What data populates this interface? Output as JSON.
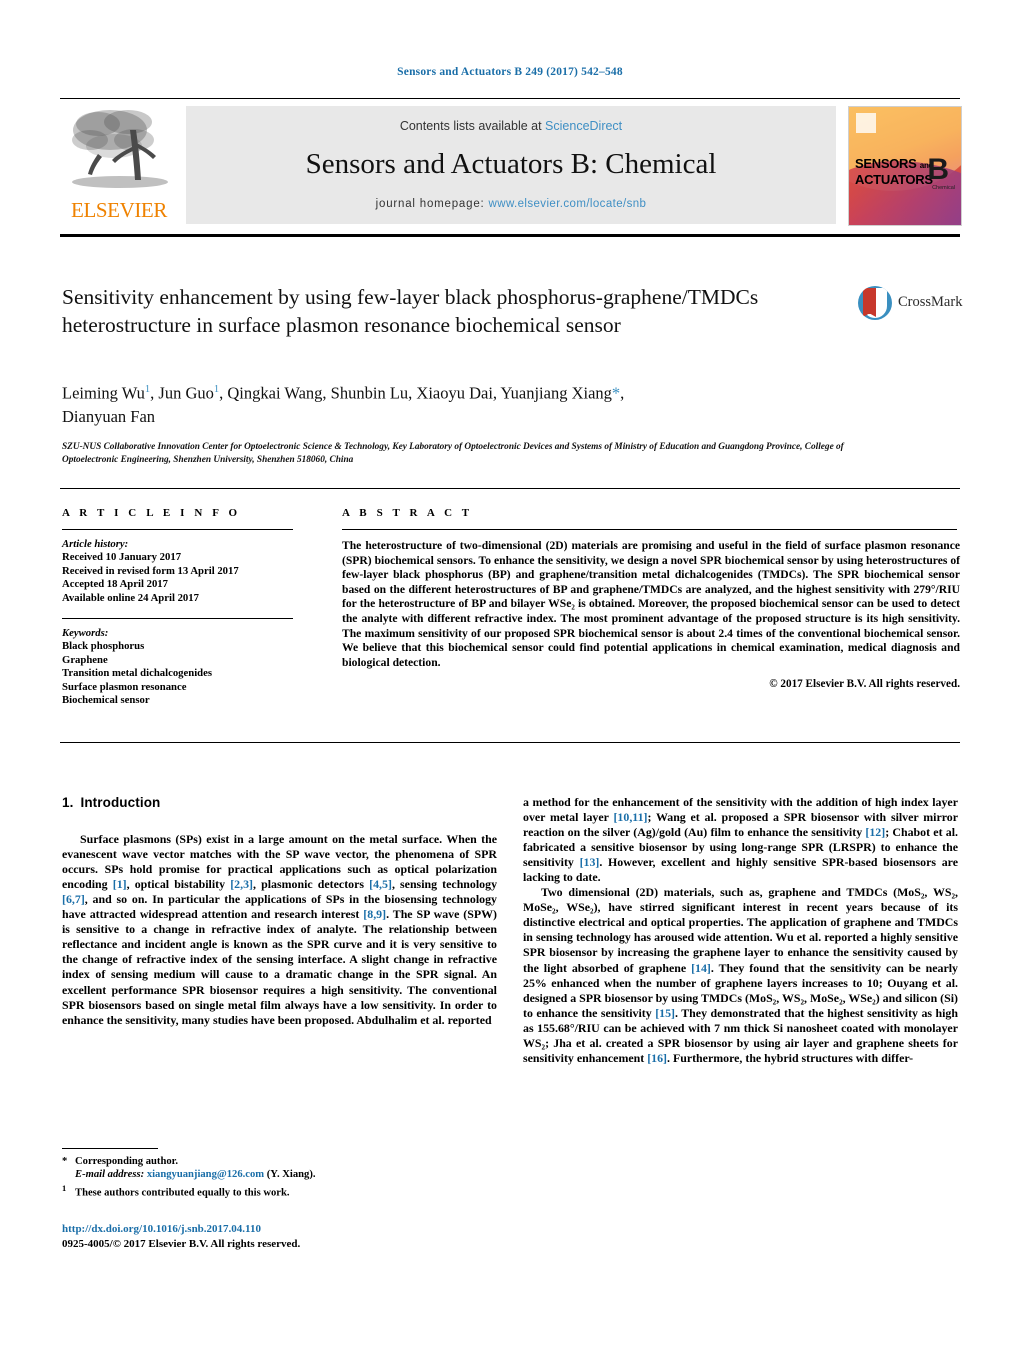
{
  "running_head": "Sensors and Actuators B 249 (2017) 542–548",
  "masthead": {
    "contents_prefix": "Contents lists available at ",
    "sciencedirect": "ScienceDirect",
    "journal_title": "Sensors and Actuators B: Chemical",
    "homepage_label": "journal homepage:",
    "homepage_url": "www.elsevier.com/locate/snb",
    "publisher": "ELSEVIER",
    "cover_line1": "SENSORS",
    "cover_and": "and",
    "cover_line2": "ACTUATORS",
    "cover_letter": "B",
    "cover_sub": "Chemical"
  },
  "article": {
    "title": "Sensitivity enhancement by using few-layer black phosphorus-graphene/TMDCs heterostructure in surface plasmon resonance biochemical sensor",
    "crossmark_label": "CrossMark",
    "authors_line1_a": "Leiming Wu",
    "authors_line1_b": ", Jun Guo",
    "authors_line1_c": ", Qingkai Wang, Shunbin Lu, Xiaoyu Dai, Yuanjiang Xiang",
    "authors_line2": "Dianyuan Fan",
    "author_mark_1": "1",
    "author_star": "*",
    "affiliation": "SZU-NUS Collaborative Innovation Center for Optoelectronic Science & Technology, Key Laboratory of Optoelectronic Devices and Systems of Ministry of Education and Guangdong Province, College of Optoelectronic Engineering, Shenzhen University, Shenzhen 518060, China"
  },
  "article_info": {
    "heading": "A R T I C L E   I N F O",
    "history_label": "Article history:",
    "history": [
      "Received 10 January 2017",
      "Received in revised form 13 April 2017",
      "Accepted 18 April 2017",
      "Available online 24 April 2017"
    ],
    "keywords_label": "Keywords:",
    "keywords": [
      "Black phosphorus",
      "Graphene",
      "Transition metal dichalcogenides",
      "Surface plasmon resonance",
      "Biochemical sensor"
    ]
  },
  "abstract": {
    "heading": "A B S T R A C T",
    "text": "The heterostructure of two-dimensional (2D) materials are promising and useful in the field of surface plasmon resonance (SPR) biochemical sensors. To enhance the sensitivity, we design a novel SPR biochemical sensor by using heterostructures of few-layer black phosphorus (BP) and graphene/transition metal dichalcogenides (TMDCs). The SPR biochemical sensor based on the different heterostructures of BP and graphene/TMDCs are analyzed, and the highest sensitivity with 279°/RIU for the heterostructure of BP and bilayer WSe₂ is obtained. Moreover, the proposed biochemical sensor can be used to detect the analyte with different refractive index. The most prominent advantage of the proposed structure is its high sensitivity. The maximum sensitivity of our proposed SPR biochemical sensor is about 2.4 times of the conventional biochemical sensor. We believe that this biochemical sensor could find potential applications in chemical examination, medical diagnosis and biological detection.",
    "copyright": "© 2017 Elsevier B.V. All rights reserved."
  },
  "sections": {
    "intro_number": "1.",
    "intro_title": "Introduction"
  },
  "body_left": {
    "p1_a": "Surface plasmons (SPs) exist in a large amount on the metal surface. When the evanescent wave vector matches with the SP wave vector, the phenomena of SPR occurs. SPs hold promise for practical applications such as optical polarization encoding ",
    "r1": "[1]",
    "p1_b": ", optical bistability ",
    "r2": "[2,3]",
    "p1_c": ", plasmonic detectors ",
    "r3": "[4,5]",
    "p1_d": ", sensing technology ",
    "r4": "[6,7]",
    "p1_e": ", and so on. In particular the applications of SPs in the biosensing technology have attracted widespread attention and research interest ",
    "r5": "[8,9]",
    "p1_f": ". The SP wave (SPW) is sensitive to a change in refractive index of analyte. The relationship between reflectance and incident angle is known as the SPR curve and it is very sensitive to the change of refractive index of the sensing interface. A slight change in refractive index of sensing medium will cause to a dramatic change in the SPR signal. An excellent performance SPR biosensor requires a high sensitivity. The conventional SPR biosensors based on single metal film always have a low sensitivity. In order to enhance the sensitivity, many studies have been proposed. Abdulhalim et al. reported"
  },
  "body_right": {
    "p1_a": "a method for the enhancement of the sensitivity with the addition of high index layer over metal layer ",
    "r1": "[10,11]",
    "p1_b": "; Wang et al. proposed a SPR biosensor with silver mirror reaction on the silver (Ag)/gold (Au) film to enhance the sensitivity ",
    "r2": "[12]",
    "p1_c": "; Chabot et al. fabricated a sensitive biosensor by using long-range SPR (LRSPR) to enhance the sensitivity ",
    "r3": "[13]",
    "p1_d": ". However, excellent and highly sensitive SPR-based biosensors are lacking to date.",
    "p2_a": "Two dimensional (2D) materials, such as, graphene and TMDCs (MoS₂, WS₂, MoSe₂, WSe₂), have stirred significant interest in recent years because of its distinctive electrical and optical properties. The application of graphene and TMDCs in sensing technology has aroused wide attention. Wu et al. reported a highly sensitive SPR biosensor by increasing the graphene layer to enhance the sensitivity caused by the light absorbed of graphene ",
    "r4": "[14]",
    "p2_b": ". They found that the sensitivity can be nearly 25% enhanced when the number of graphene layers increases to 10; Ouyang et al. designed a SPR biosensor by using TMDCs (MoS₂, WS₂, MoSe₂, WSe₂) and silicon (Si) to enhance the sensitivity ",
    "r5": "[15]",
    "p2_c": ". They demonstrated that the highest sensitivity as high as 155.68°/RIU can be achieved with 7 nm thick Si nanosheet coated with monolayer WS₂; Jha et al. created a SPR biosensor by using air layer and graphene sheets for sensitivity enhancement ",
    "r6": "[16]",
    "p2_d": ". Furthermore, the hybrid structures with differ-"
  },
  "footnotes": {
    "star_mark": "*",
    "corresponding": "Corresponding author.",
    "email_label": "E-mail address:",
    "email": "xiangyuanjiang@126.com",
    "email_suffix": "(Y. Xiang).",
    "one_mark": "1",
    "equal_contrib": "These authors contributed equally to this work."
  },
  "doi_block": {
    "doi": "http://dx.doi.org/10.1016/j.snb.2017.04.110",
    "issn_line": "0925-4005/© 2017 Elsevier B.V. All rights reserved."
  },
  "colors": {
    "link": "#1a6ea8",
    "elsevier_orange": "#ef8200",
    "banner_bg": "#e8e8e8"
  }
}
